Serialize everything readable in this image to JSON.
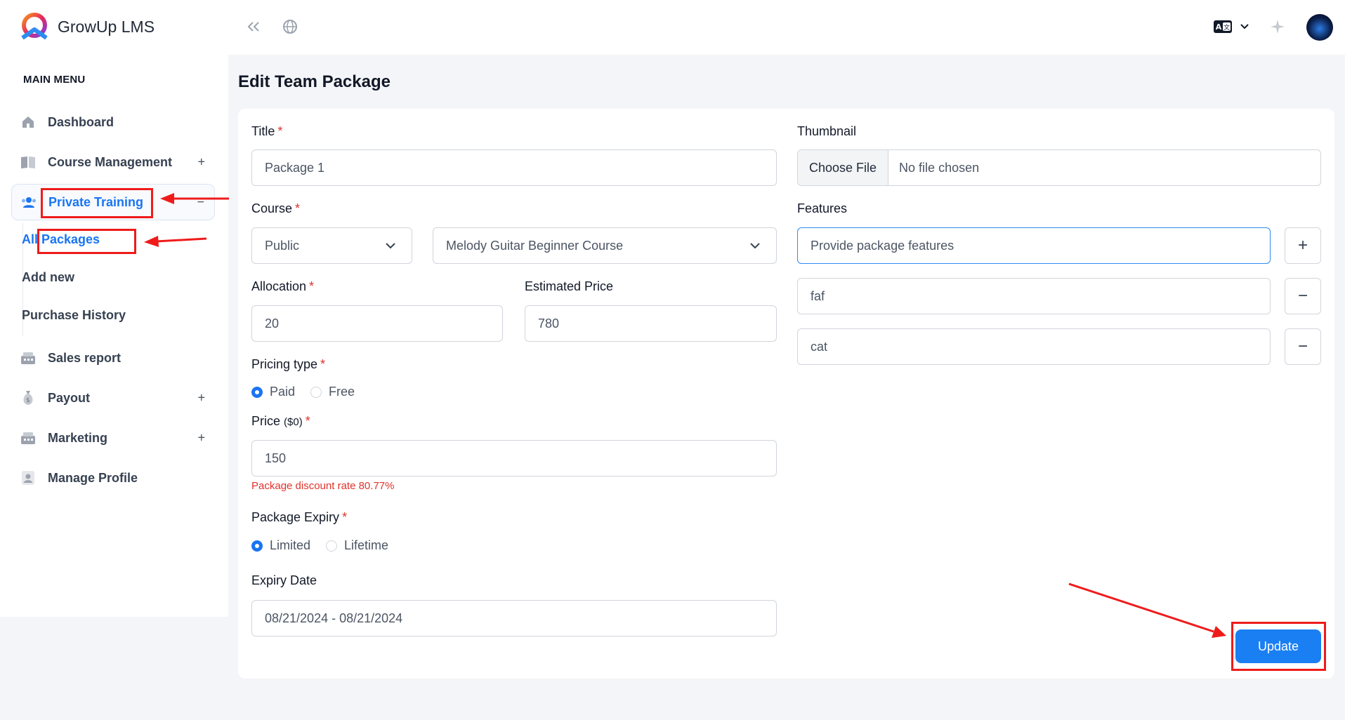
{
  "brand": {
    "name": "GrowUp LMS"
  },
  "sidebar": {
    "heading": "MAIN MENU",
    "items": [
      {
        "label": "Dashboard",
        "icon": "home-icon"
      },
      {
        "label": "Course Management",
        "icon": "book-icon",
        "toggle": "+"
      },
      {
        "label": "Private Training",
        "icon": "users-icon",
        "toggle": "−",
        "active": true
      },
      {
        "label": "Sales report",
        "icon": "cart-icon"
      },
      {
        "label": "Payout",
        "icon": "money-bag-icon",
        "toggle": "+"
      },
      {
        "label": "Marketing",
        "icon": "cart-icon",
        "toggle": "+"
      },
      {
        "label": "Manage Profile",
        "icon": "profile-icon"
      }
    ],
    "subitems": [
      {
        "label": "All Packages",
        "active": true
      },
      {
        "label": "Add new"
      },
      {
        "label": "Purchase History"
      }
    ]
  },
  "topbar": {
    "icons": [
      "collapse-icon",
      "globe-icon",
      "language-icon",
      "chevron-down-icon",
      "sparkle-icon",
      "avatar"
    ]
  },
  "page": {
    "title": "Edit Team Package"
  },
  "form": {
    "title_label": "Title",
    "title_value": "Package 1",
    "course_label": "Course",
    "course_visibility": "Public",
    "course_name": "Melody Guitar Beginner Course",
    "allocation_label": "Allocation",
    "allocation_value": "20",
    "estimated_price_label": "Estimated Price",
    "estimated_price_value": "780",
    "pricing_type_label": "Pricing type",
    "pricing_options": [
      "Paid",
      "Free"
    ],
    "pricing_selected": "Paid",
    "price_label": "Price",
    "price_unit": "($0)",
    "price_value": "150",
    "discount_hint": "Package discount rate 80.77%",
    "expiry_label": "Package Expiry",
    "expiry_options": [
      "Limited",
      "Lifetime"
    ],
    "expiry_selected": "Limited",
    "expiry_date_label": "Expiry Date",
    "expiry_date_value": "08/21/2024 - 08/21/2024",
    "thumbnail_label": "Thumbnail",
    "file_button": "Choose File",
    "file_status": "No file chosen",
    "features_label": "Features",
    "features_placeholder": "Provide package features",
    "features": [
      "faf",
      "cat"
    ],
    "add_symbol": "+",
    "remove_symbol": "−",
    "required_mark": "*",
    "update_label": "Update"
  },
  "colors": {
    "accent": "#1a75f2",
    "annotation": "#ef1b1b",
    "required": "#e0322b"
  }
}
